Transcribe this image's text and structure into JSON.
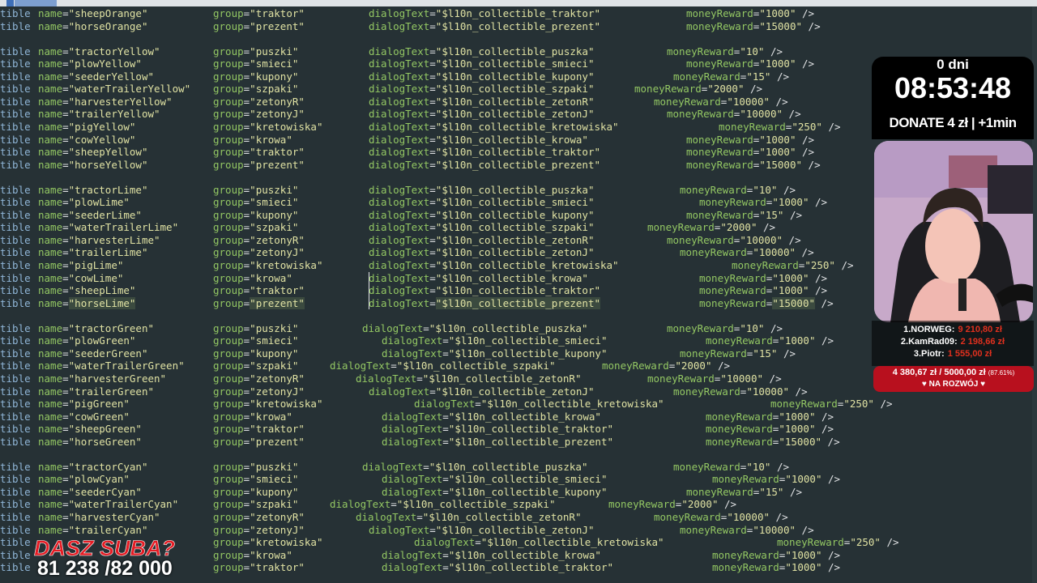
{
  "editor": {
    "lines": [
      {
        "row": 0,
        "name": "name=\"sheepOrange\"",
        "group": "group=\"traktor\"",
        "dialog": "dialogText=\"$l10n_collectible_traktor\"",
        "reward": "moneyReward=\"1000\" />",
        "xd": 455,
        "xm": 847
      },
      {
        "row": 1,
        "name": "name=\"horseOrange\"",
        "group": "group=\"prezent\"",
        "dialog": "dialogText=\"$l10n_collectible_prezent\"",
        "reward": "moneyReward=\"15000\" />",
        "xd": 455,
        "xm": 847
      },
      {
        "row": 3,
        "name": "name=\"tractorYellow\"",
        "group": "group=\"puszki\"",
        "dialog": "dialogText=\"$l10n_collectible_puszka\"",
        "reward": "moneyReward=\"10\" />",
        "xd": 455,
        "xm": 823
      },
      {
        "row": 4,
        "name": "name=\"plowYellow\"",
        "group": "group=\"smieci\"",
        "dialog": "dialogText=\"$l10n_collectible_smieci\"",
        "reward": "moneyReward=\"1000\" />",
        "xd": 455,
        "xm": 847
      },
      {
        "row": 5,
        "name": "name=\"seederYellow\"",
        "group": "group=\"kupony\"",
        "dialog": "dialogText=\"$l10n_collectible_kupony\"",
        "reward": "moneyReward=\"15\" />",
        "xd": 455,
        "xm": 831
      },
      {
        "row": 6,
        "name": "name=\"waterTrailerYellow\"",
        "group": "group=\"szpaki\"",
        "dialog": "dialogText=\"$l10n_collectible_szpaki\"",
        "reward": "moneyReward=\"2000\" />",
        "xd": 455,
        "xm": 783
      },
      {
        "row": 7,
        "name": "name=\"harvesterYellow\"",
        "group": "group=\"zetonyR\"",
        "dialog": "dialogText=\"$l10n_collectible_zetonR\"",
        "reward": "moneyReward=\"10000\" />",
        "xd": 455,
        "xm": 807
      },
      {
        "row": 8,
        "name": "name=\"trailerYellow\"",
        "group": "group=\"zetonyJ\"",
        "dialog": "dialogText=\"$l10n_collectible_zetonJ\"",
        "reward": "moneyReward=\"10000\" />",
        "xd": 455,
        "xm": 823
      },
      {
        "row": 9,
        "name": "name=\"pigYellow\"",
        "group": "group=\"kretowiska\"",
        "dialog": "dialogText=\"$l10n_collectible_kretowiska\"",
        "reward": "moneyReward=\"250\" />",
        "xd": 455,
        "xm": 887
      },
      {
        "row": 10,
        "name": "name=\"cowYellow\"",
        "group": "group=\"krowa\"",
        "dialog": "dialogText=\"$l10n_collectible_krowa\"",
        "reward": "moneyReward=\"1000\" />",
        "xd": 455,
        "xm": 847
      },
      {
        "row": 11,
        "name": "name=\"sheepYellow\"",
        "group": "group=\"traktor\"",
        "dialog": "dialogText=\"$l10n_collectible_traktor\"",
        "reward": "moneyReward=\"1000\" />",
        "xd": 455,
        "xm": 847
      },
      {
        "row": 12,
        "name": "name=\"horseYellow\"",
        "group": "group=\"prezent\"",
        "dialog": "dialogText=\"$l10n_collectible_prezent\"",
        "reward": "moneyReward=\"15000\" />",
        "xd": 455,
        "xm": 847
      },
      {
        "row": 14,
        "name": "name=\"tractorLime\"",
        "group": "group=\"puszki\"",
        "dialog": "dialogText=\"$l10n_collectible_puszka\"",
        "reward": "moneyReward=\"10\" />",
        "xd": 455,
        "xm": 839
      },
      {
        "row": 15,
        "name": "name=\"plowLime\"",
        "group": "group=\"smieci\"",
        "dialog": "dialogText=\"$l10n_collectible_smieci\"",
        "reward": "moneyReward=\"1000\" />",
        "xd": 455,
        "xm": 863
      },
      {
        "row": 16,
        "name": "name=\"seederLime\"",
        "group": "group=\"kupony\"",
        "dialog": "dialogText=\"$l10n_collectible_kupony\"",
        "reward": "moneyReward=\"15\" />",
        "xd": 455,
        "xm": 847
      },
      {
        "row": 17,
        "name": "name=\"waterTrailerLime\"",
        "group": "group=\"szpaki\"",
        "dialog": "dialogText=\"$l10n_collectible_szpaki\"",
        "reward": "moneyReward=\"2000\" />",
        "xd": 455,
        "xm": 799
      },
      {
        "row": 18,
        "name": "name=\"harvesterLime\"",
        "group": "group=\"zetonyR\"",
        "dialog": "dialogText=\"$l10n_collectible_zetonR\"",
        "reward": "moneyReward=\"10000\" />",
        "xd": 455,
        "xm": 823
      },
      {
        "row": 19,
        "name": "name=\"trailerLime\"",
        "group": "group=\"zetonyJ\"",
        "dialog": "dialogText=\"$l10n_collectible_zetonJ\"",
        "reward": "moneyReward=\"10000\" />",
        "xd": 455,
        "xm": 839
      },
      {
        "row": 20,
        "name": "name=\"pigLime\"",
        "group": "group=\"kretowiska\"",
        "dialog": "dialogText=\"$l10n_collectible_kretowiska\"",
        "reward": "moneyReward=\"250\" />",
        "xd": 455,
        "xm": 903
      },
      {
        "row": 21,
        "name": "name=\"cowLime\"",
        "group": "group=\"krowa\"",
        "dialog": "dialogText=\"$l10n_collectible_krowa\"",
        "reward": "moneyReward=\"1000\" />",
        "xd": 455,
        "xm": 863
      },
      {
        "row": 22,
        "name": "name=\"sheepLime\"",
        "group": "group=\"traktor\"",
        "dialog": "dialogText=\"$l10n_collectible_traktor\"",
        "reward": "moneyReward=\"1000\" />",
        "xd": 455,
        "xm": 863
      },
      {
        "row": 23,
        "name": "name=\"horseLime\"",
        "group": "group=\"prezent\"",
        "dialog": "dialogText=\"$l10n_collectible_prezent\"",
        "reward": "moneyReward=\"15000\" />",
        "xd": 455,
        "xm": 863,
        "hl": true
      },
      {
        "row": 25,
        "name": "name=\"tractorGreen\"",
        "group": "group=\"puszki\"",
        "dialog": "dialogText=\"$l10n_collectible_puszka\"",
        "reward": "moneyReward=\"10\" />",
        "xd": 447,
        "xm": 823
      },
      {
        "row": 26,
        "name": "name=\"plowGreen\"",
        "group": "group=\"smieci\"",
        "dialog": "dialogText=\"$l10n_collectible_smieci\"",
        "reward": "moneyReward=\"1000\" />",
        "xd": 471,
        "xm": 871
      },
      {
        "row": 27,
        "name": "name=\"seederGreen\"",
        "group": "group=\"kupony\"",
        "dialog": "dialogText=\"$l10n_collectible_kupony\"",
        "reward": "moneyReward=\"15\" />",
        "xd": 471,
        "xm": 839
      },
      {
        "row": 28,
        "name": "name=\"waterTrailerGreen\"",
        "group": "group=\"szpaki\"",
        "dialog": "dialogText=\"$l10n_collectible_szpaki\"",
        "reward": "moneyReward=\"2000\" />",
        "xd": 407,
        "xm": 743
      },
      {
        "row": 29,
        "name": "name=\"harvesterGreen\"",
        "group": "group=\"zetonyR\"",
        "dialog": "dialogText=\"$l10n_collectible_zetonR\"",
        "reward": "moneyReward=\"10000\" />",
        "xd": 439,
        "xm": 799
      },
      {
        "row": 30,
        "name": "name=\"trailerGreen\"",
        "group": "group=\"zetonyJ\"",
        "dialog": "dialogText=\"$l10n_collectible_zetonJ\"",
        "reward": "moneyReward=\"10000\" />",
        "xd": 455,
        "xm": 831
      },
      {
        "row": 31,
        "name": "name=\"pigGreen\"",
        "group": "group=\"kretowiska\"",
        "dialog": "dialogText=\"$l10n_collectible_kretowiska\"",
        "reward": "moneyReward=\"250\" />",
        "xd": 511,
        "xm": 951
      },
      {
        "row": 32,
        "name": "name=\"cowGreen\"",
        "group": "group=\"krowa\"",
        "dialog": "dialogText=\"$l10n_collectible_krowa\"",
        "reward": "moneyReward=\"1000\" />",
        "xd": 471,
        "xm": 871
      },
      {
        "row": 33,
        "name": "name=\"sheepGreen\"",
        "group": "group=\"traktor\"",
        "dialog": "dialogText=\"$l10n_collectible_traktor\"",
        "reward": "moneyReward=\"1000\" />",
        "xd": 471,
        "xm": 871
      },
      {
        "row": 34,
        "name": "name=\"horseGreen\"",
        "group": "group=\"prezent\"",
        "dialog": "dialogText=\"$l10n_collectible_prezent\"",
        "reward": "moneyReward=\"15000\" />",
        "xd": 471,
        "xm": 871
      },
      {
        "row": 36,
        "name": "name=\"tractorCyan\"",
        "group": "group=\"puszki\"",
        "dialog": "dialogText=\"$l10n_collectible_puszka\"",
        "reward": "moneyReward=\"10\" />",
        "xd": 447,
        "xm": 831
      },
      {
        "row": 37,
        "name": "name=\"plowCyan\"",
        "group": "group=\"smieci\"",
        "dialog": "dialogText=\"$l10n_collectible_smieci\"",
        "reward": "moneyReward=\"1000\" />",
        "xd": 471,
        "xm": 879
      },
      {
        "row": 38,
        "name": "name=\"seederCyan\"",
        "group": "group=\"kupony\"",
        "dialog": "dialogText=\"$l10n_collectible_kupony\"",
        "reward": "moneyReward=\"15\" />",
        "xd": 471,
        "xm": 847
      },
      {
        "row": 39,
        "name": "name=\"waterTrailerCyan\"",
        "group": "group=\"szpaki\"",
        "dialog": "dialogText=\"$l10n_collectible_szpaki\"",
        "reward": "moneyReward=\"2000\" />",
        "xd": 407,
        "xm": 751
      },
      {
        "row": 40,
        "name": "name=\"harvesterCyan\"",
        "group": "group=\"zetonyR\"",
        "dialog": "dialogText=\"$l10n_collectible_zetonR\"",
        "reward": "moneyReward=\"10000\" />",
        "xd": 439,
        "xm": 807
      },
      {
        "row": 41,
        "name": "name=\"trailerCyan\"",
        "group": "group=\"zetonyJ\"",
        "dialog": "dialogText=\"$l10n_collectible_zetonJ\"",
        "reward": "moneyReward=\"10000\" />",
        "xd": 455,
        "xm": 839
      },
      {
        "row": 42,
        "name": "",
        "group": "group=\"kretowiska\"",
        "dialog": "dialogText=\"$l10n_collectible_kretowiska\"",
        "reward": "moneyReward=\"250\" />",
        "xd": 511,
        "xm": 959
      },
      {
        "row": 43,
        "name": "",
        "group": "group=\"krowa\"",
        "dialog": "dialogText=\"$l10n_collectible_krowa\"",
        "reward": "moneyReward=\"1000\" />",
        "xd": 471,
        "xm": 879
      },
      {
        "row": 44,
        "name": "",
        "group": "group=\"traktor\"",
        "dialog": "dialogText=\"$l10n_collectible_traktor\"",
        "reward": "moneyReward=\"1000\" />",
        "xd": 471,
        "xm": 879
      }
    ],
    "keyword": "tible"
  },
  "overlay": {
    "timer_days": "0 dni",
    "timer_clock": "08:53:48",
    "donate_text": "DONATE  4 zł | +1min",
    "leaderboard": [
      {
        "label": "1.NORWEG:",
        "amount": "9 210,80 zł"
      },
      {
        "label": "2.KamRad09:",
        "amount": "2 198,66 zł"
      },
      {
        "label": "3.Piotr:",
        "amount": "1 555,00 zł"
      }
    ],
    "goal_amount": "4 380,67 zł / 5000,00 zł",
    "goal_percent": "(87.61%)",
    "goal_label": "♥ NA ROZWÓJ ♥",
    "subs_title": "DASZ SUBA?",
    "subs_count": "81 238 /82 000"
  },
  "colors": {
    "background": "#263135",
    "attribute": "#93c763",
    "string": "#e0e2a3",
    "keyword": "#8fb5d6",
    "goal": "#b8101e",
    "leader_amount": "#e0301e"
  }
}
